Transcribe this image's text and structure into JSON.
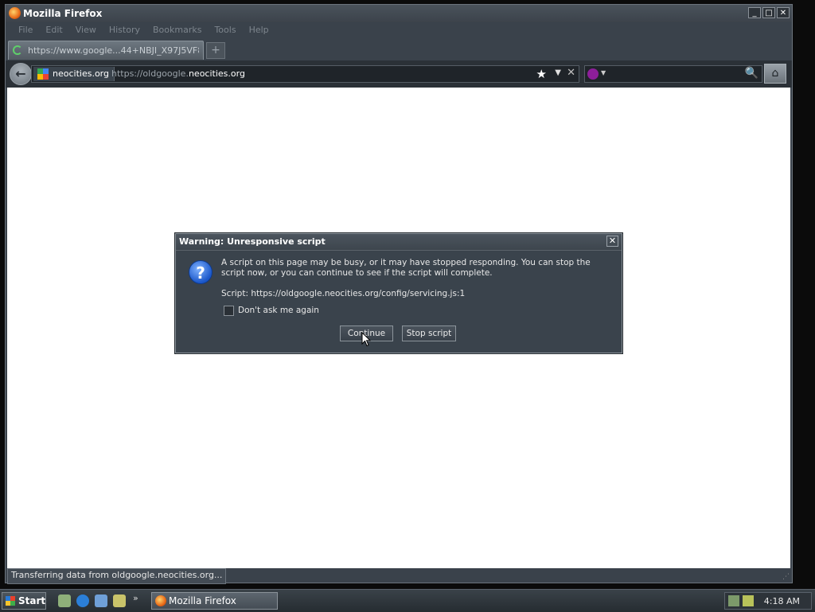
{
  "window": {
    "title": "Mozilla Firefox"
  },
  "menu": [
    "File",
    "Edit",
    "View",
    "History",
    "Bookmarks",
    "Tools",
    "Help"
  ],
  "tab": {
    "label": "https://www.google...44+NBJI_X97J5VF8hu"
  },
  "navbar": {
    "identity_label": "neocities.org",
    "url_prefix": "https://oldgoogle.",
    "url_host": "neocities.org",
    "search_placeholder": ""
  },
  "status": {
    "text": "Transferring data from oldgoogle.neocities.org..."
  },
  "dialog": {
    "title": "Warning: Unresponsive script",
    "message": "A script on this page may be busy, or it may have stopped responding. You can stop the script now, or you can continue to see if the script will complete.",
    "script_line": "Script: https://oldgoogle.neocities.org/config/servicing.js:1",
    "checkbox_label": "Don't ask me again",
    "checkbox_checked": false,
    "continue_label": "Continue",
    "stop_label": "Stop script"
  },
  "taskbar": {
    "start_label": "Start",
    "task_label": "Mozilla Firefox",
    "clock": "4:18 AM"
  },
  "icons": {
    "app": "firefox-icon",
    "back": "back-arrow-icon",
    "bookmark": "star-icon",
    "home": "home-icon",
    "search": "magnifier-icon",
    "dialog": "question-icon"
  }
}
